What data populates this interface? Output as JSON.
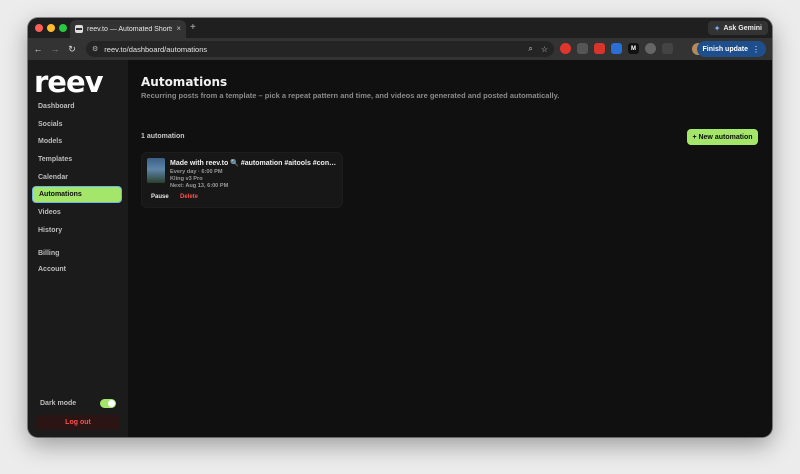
{
  "browser": {
    "tab_title": "reev.to — Automated Shorts",
    "tab_close": "×",
    "new_tab": "+",
    "ask_gemini": "Ask Gemini",
    "url": "reev.to/dashboard/automations",
    "finish_update": "Finish update",
    "icons": {
      "back": "←",
      "forward": "→",
      "reload": "↻",
      "tune": "⚙",
      "zoom": "⌕",
      "bookmark": "☆",
      "gemini": "✦",
      "menu": "⋮"
    },
    "extensions": [
      "",
      "",
      "",
      "",
      "M",
      "",
      ""
    ]
  },
  "sidebar": {
    "logo": "reev",
    "items": [
      {
        "label": "Dashboard"
      },
      {
        "label": "Socials"
      },
      {
        "label": "Models"
      },
      {
        "label": "Templates"
      },
      {
        "label": "Calendar"
      },
      {
        "label": "Automations",
        "active": true
      },
      {
        "label": "Videos"
      },
      {
        "label": "History"
      },
      {
        "label": "Billing"
      },
      {
        "label": "Account"
      }
    ],
    "dark_mode_label": "Dark mode",
    "dark_mode_on": true,
    "logout": "Log out"
  },
  "main": {
    "title": "Automations",
    "subtitle": "Recurring posts from a template – pick a repeat pattern and time, and videos are generated and posted automatically.",
    "count": "1 automation",
    "new_button": "+ New automation",
    "automations": [
      {
        "title": "Made with reev.to 🔍 #automation #aitools #con…",
        "schedule": "Every day · 6:00 PM",
        "model": "Kling v3 Pro",
        "next_run": "Next: Aug 13, 6:00 PM",
        "pause": "Pause",
        "delete": "Delete"
      }
    ]
  },
  "colors": {
    "accent": "#a3e66a",
    "danger": "#ff4d4d",
    "background": "#101010",
    "sidebar": "#1b1b1b"
  }
}
